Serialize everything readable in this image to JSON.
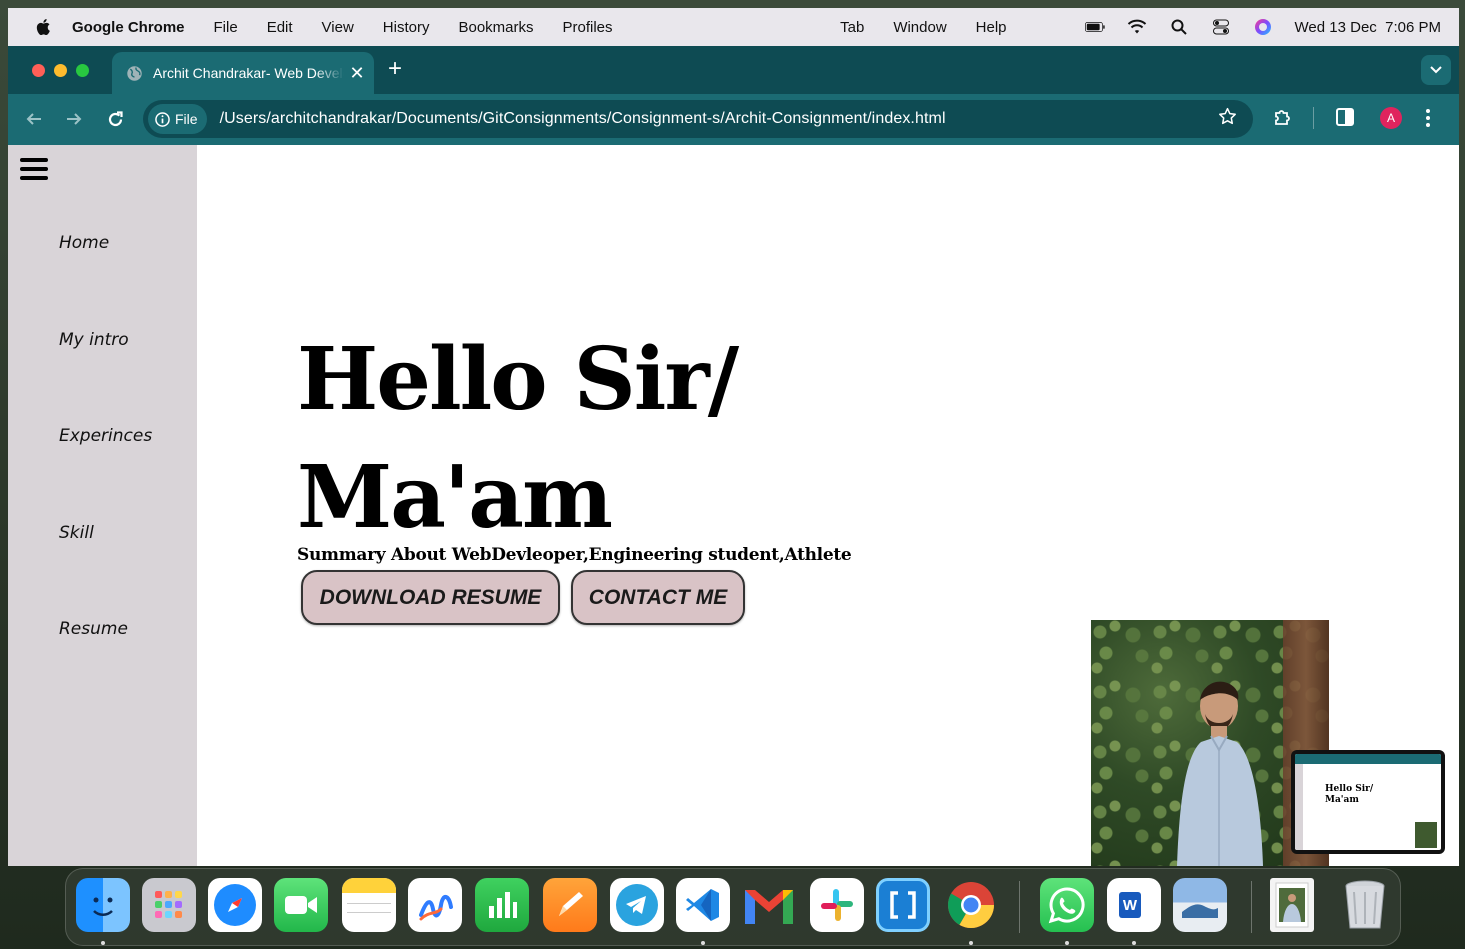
{
  "menubar": {
    "app": "Google Chrome",
    "items": [
      "File",
      "Edit",
      "View",
      "History",
      "Bookmarks",
      "Profiles",
      "Tab",
      "Window",
      "Help"
    ],
    "clock": "Wed 13 Dec  7:06 PM"
  },
  "browser": {
    "tab_title": "Archit Chandrakar- Web Developer",
    "new_tab": "+",
    "chip_label": "File",
    "url": "/Users/architchandrakar/Documents/GitConsignments/Consignment-s/Archit-Consignment/index.html",
    "avatar_letter": "A"
  },
  "sidebar": {
    "items": [
      "Home",
      "My intro",
      "Experinces",
      "Skill",
      "Resume"
    ]
  },
  "hero": {
    "line1": "Hello Sir/",
    "line2": "Ma'am",
    "summary": "Summary About WebDevleoper,Engineering student,Athlete",
    "download_label": "DOWNLOAD RESUME",
    "contact_label": "CONTACT ME"
  },
  "pip": {
    "line1": "Hello Sir/",
    "line2": "Ma'am"
  },
  "dock": {
    "apps": [
      "finder-icon",
      "launchpad-icon",
      "safari-icon",
      "facetime-icon",
      "notes-icon",
      "freeform-icon",
      "numbers-icon",
      "pages-icon",
      "telegram-icon",
      "vscode-icon",
      "gmail-icon",
      "slack-icon",
      "brackets-icon",
      "chrome-icon",
      "whatsapp-icon",
      "word-icon",
      "preview-icon",
      "image-file-icon",
      "trash-icon"
    ],
    "word_letter": "W"
  },
  "colors": {
    "chrome_dark": "#0e4b53",
    "chrome_light": "#1b6b73",
    "sidebar_bg": "#d9d4d8",
    "button_bg": "#d9c3c6"
  }
}
